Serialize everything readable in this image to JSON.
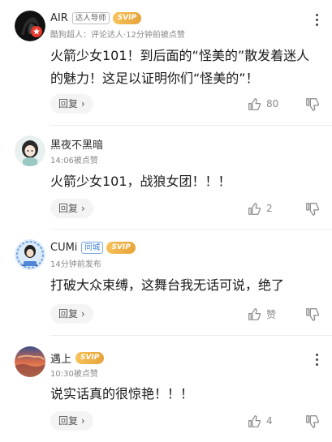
{
  "comments": [
    {
      "name": "AIR",
      "tags": [
        "达人导师"
      ],
      "svip": "SVIP",
      "meta": "酷狗超人：评论达人·12分钟前被点赞",
      "text": "火箭少女101！到后面的“怪美的”散发着迷人的魅力！这足以证明你们“怪美的”！",
      "reply_label": "回复",
      "like_count": "80"
    },
    {
      "name": "黑夜不黑暗",
      "meta": "14:06被点赞",
      "text": "火箭少女101，战狼女团！！！",
      "reply_label": "回复",
      "like_count": "2"
    },
    {
      "name": "CUMi",
      "city_tag": "同城",
      "svip": "SVIP",
      "meta": "14分钟前发布",
      "text": "打破大众束缚，这舞台我无话可说，绝了",
      "reply_label": "回复",
      "like_count": "赞"
    },
    {
      "name": "遇上",
      "svip": "SVIP",
      "meta": "10:30被点赞",
      "text": "说实话真的很惊艳！！！",
      "reply_label": "回复",
      "like_count": "4"
    }
  ],
  "avatar_badge_color": "#e8372c",
  "svip_color": "#e6a43a"
}
